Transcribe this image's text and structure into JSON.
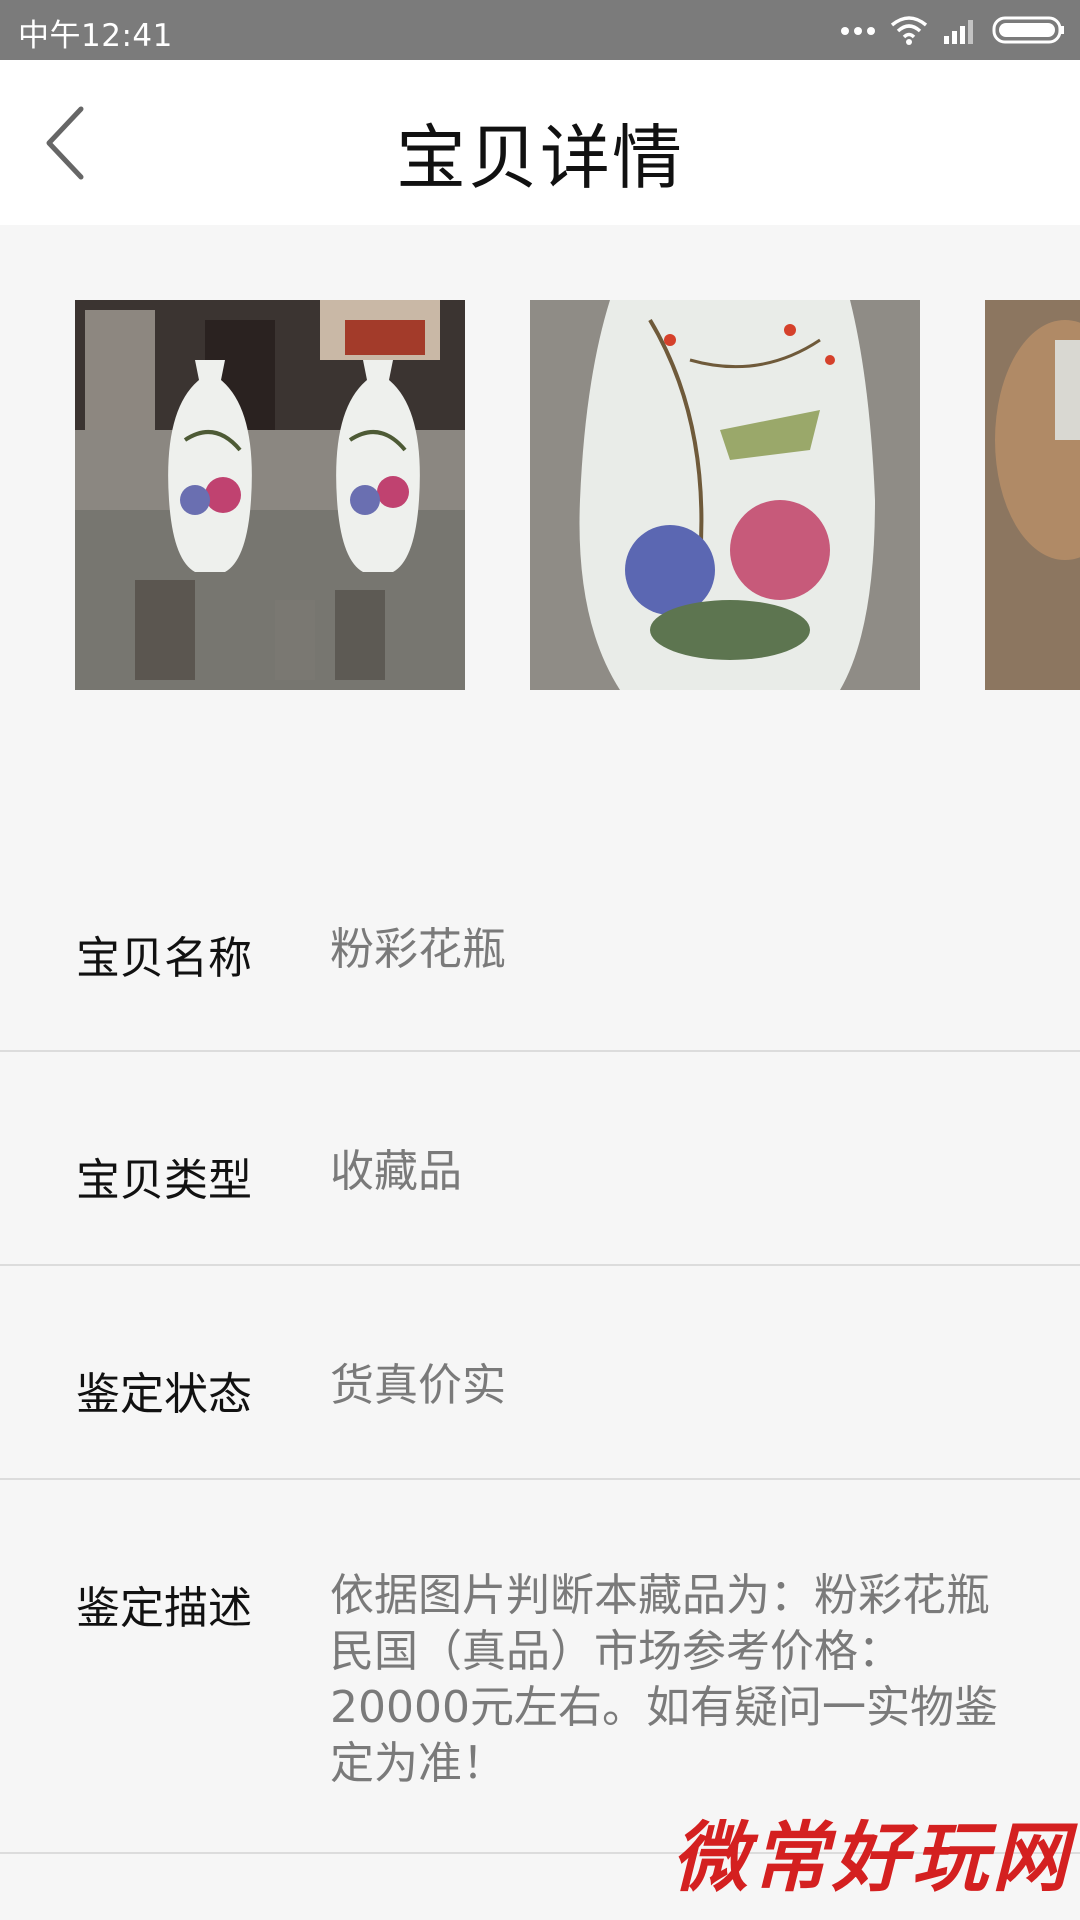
{
  "status_bar": {
    "time": "中午12:41",
    "icons": [
      "more-dots-icon",
      "wifi-icon",
      "signal-icon",
      "battery-icon"
    ]
  },
  "nav": {
    "back_icon": "chevron-left-icon",
    "title": "宝贝详情"
  },
  "gallery": {
    "photos": [
      {
        "name": "photo-two-vases"
      },
      {
        "name": "photo-vase-closeup"
      },
      {
        "name": "photo-hand-holding"
      }
    ]
  },
  "details": {
    "name_label": "宝贝名称",
    "name_value": "粉彩花瓶",
    "type_label": "宝贝类型",
    "type_value": "收藏品",
    "status_label": "鉴定状态",
    "status_value": "货真价实",
    "desc_label": "鉴定描述",
    "desc_value": "依据图片判断本藏品为：粉彩花瓶 民国（真品）市场参考价格：20000元左右。如有疑问一实物鉴定为准！"
  },
  "watermark": "微常好玩网",
  "colors": {
    "status_bar_bg": "#7b7b7b",
    "page_bg": "#f6f6f6",
    "label_text": "#111111",
    "value_text": "#7a7a7a",
    "watermark": "#d42020"
  }
}
